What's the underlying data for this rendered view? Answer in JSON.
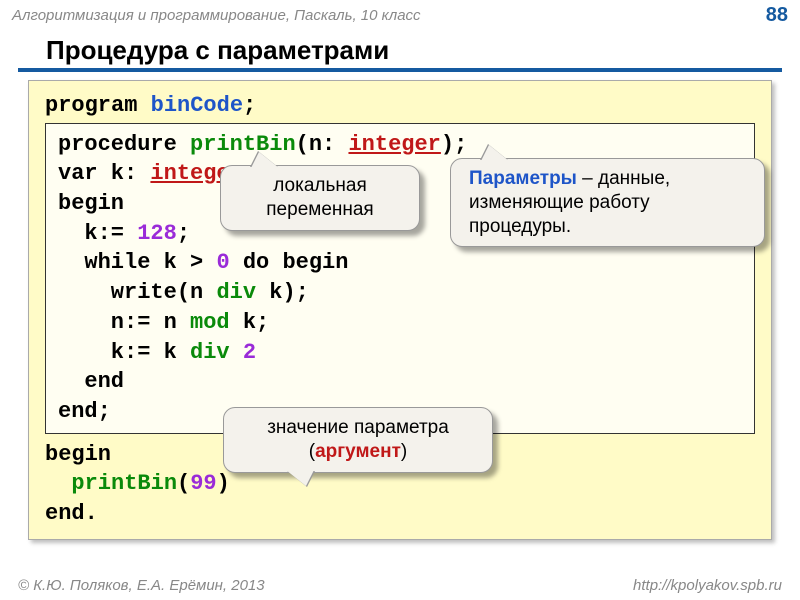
{
  "header": {
    "breadcrumb": "Алгоритмизация и программирование, Паскаль, 10 класс",
    "page": "88"
  },
  "title": "Процедура с параметрами",
  "code": {
    "l1_program": "program ",
    "l1_name": "binCode",
    "l1_semi": ";",
    "proc": {
      "l1a": "procedure ",
      "l1b": "printBin",
      "l1c": "(n: ",
      "l1d": "integer",
      "l1e": ");",
      "l2a": "var k: ",
      "l2b": "integer",
      "l2c": ";",
      "l3": "begin",
      "l4a": "  k:= ",
      "l4b": "128",
      "l4c": ";",
      "l5a": "  while k > ",
      "l5b": "0",
      "l5c": " do begin",
      "l6a": "    write(n ",
      "l6b": "div",
      "l6c": " k);",
      "l7a": "    n:= n ",
      "l7b": "mod",
      "l7c": " k;",
      "l8a": "    k:= k ",
      "l8b": "div",
      "l8c": " ",
      "l8d": "2",
      "l9": "  end",
      "l10": "end;"
    },
    "main": {
      "l1": "begin",
      "l2a": "  ",
      "l2b": "printBin",
      "l2c": "(",
      "l2d": "99",
      "l2e": ")",
      "l3": "end."
    }
  },
  "callouts": {
    "local_var": "локальная переменная",
    "params_bold": "Параметры",
    "params_rest": " – данные, изменяющие работу процедуры.",
    "arg_pre": "значение параметра (",
    "arg_bold": "аргумент",
    "arg_post": ")"
  },
  "footer": {
    "left": "© К.Ю. Поляков, Е.А. Ерёмин, 2013",
    "right": "http://kpolyakov.spb.ru"
  }
}
